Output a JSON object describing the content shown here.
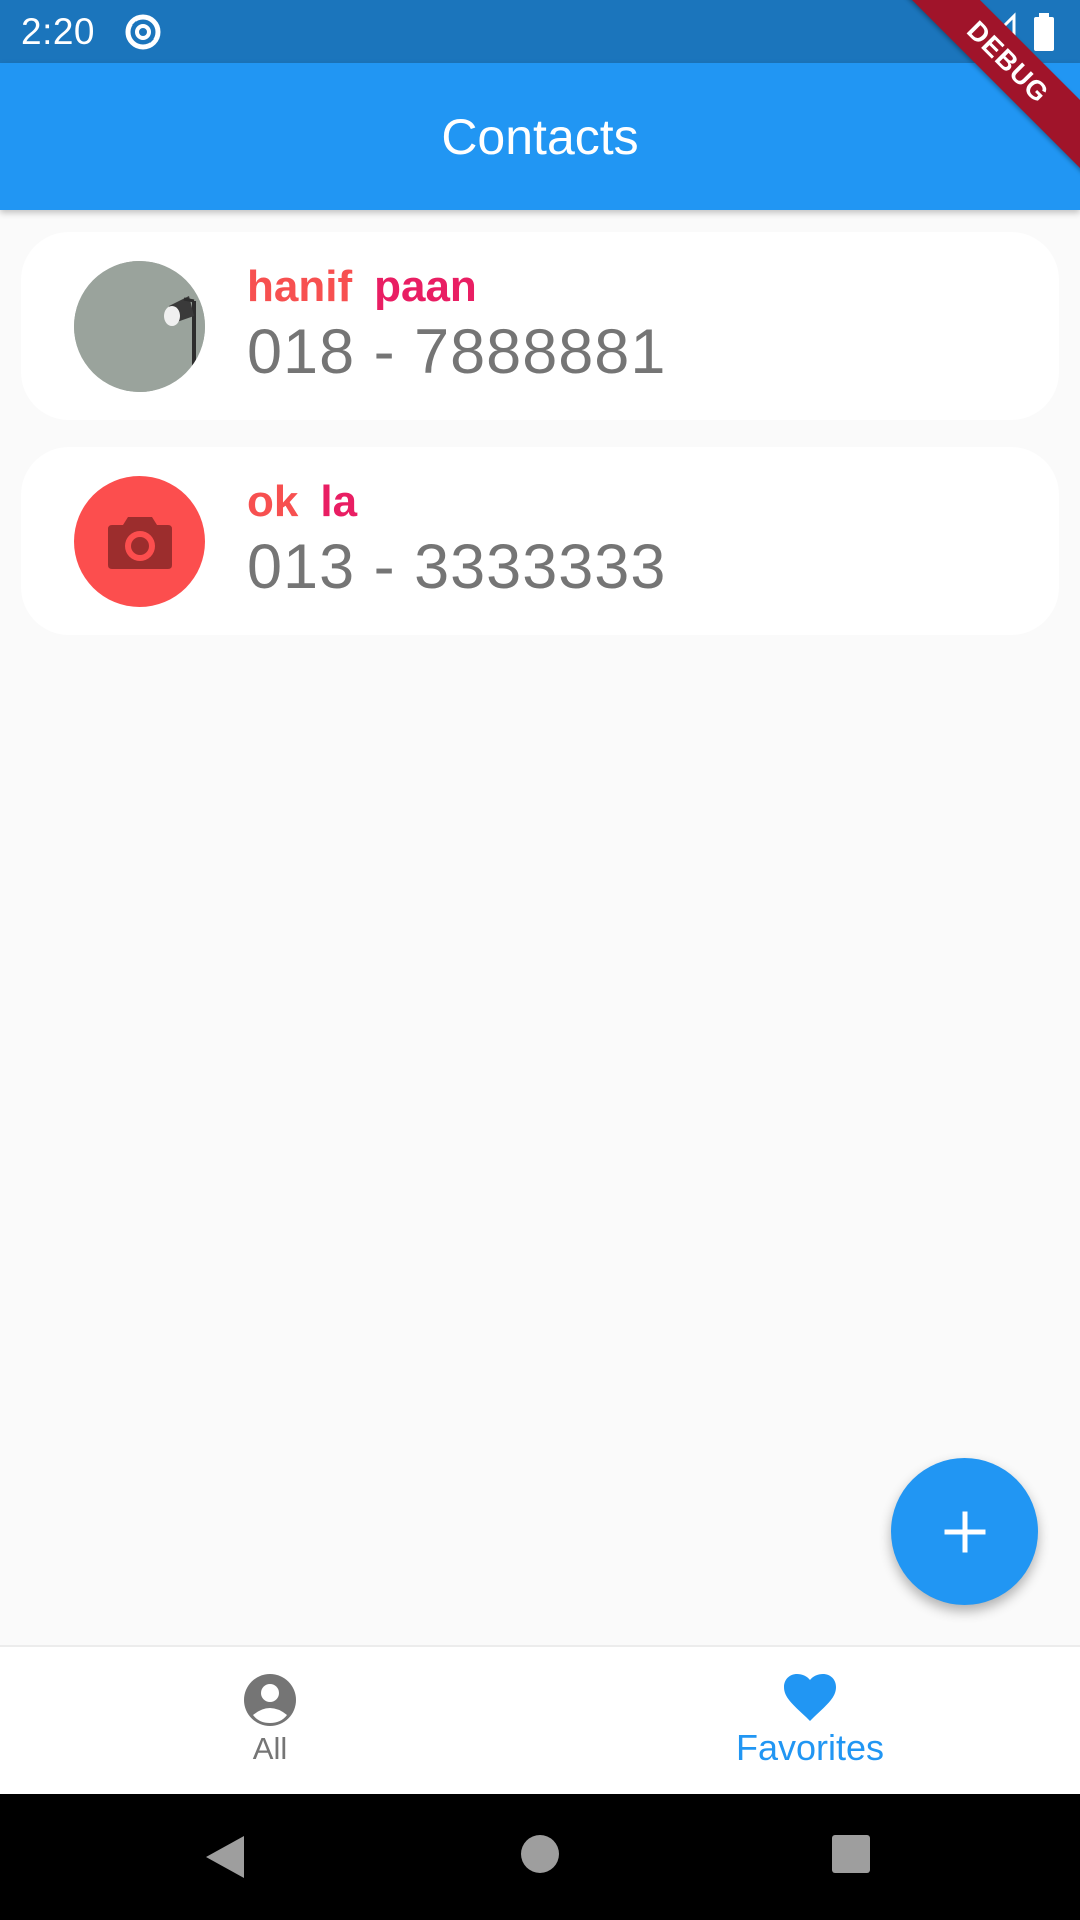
{
  "status_bar": {
    "time": "2:20",
    "app_icon": "sync-icon",
    "signal_icon": "signal-icon",
    "battery_icon": "battery-icon",
    "background": "#1b75bc"
  },
  "app_bar": {
    "title": "Contacts",
    "color": "#2196f3"
  },
  "debug_banner": {
    "label": "DEBUG"
  },
  "contacts": [
    {
      "first_name": "hanif",
      "last_name": "paan",
      "phone": "018 - 7888881",
      "avatar": "photo-avatar"
    },
    {
      "first_name": "ok",
      "last_name": "la",
      "phone": "013 - 3333333",
      "avatar": "camera-icon"
    }
  ],
  "fab": {
    "icon": "plus-icon"
  },
  "bottom_nav": {
    "items": [
      {
        "label": "All",
        "icon": "account-circle-icon",
        "selected": false
      },
      {
        "label": "Favorites",
        "icon": "heart-icon",
        "selected": true
      }
    ]
  },
  "system_nav": {
    "back": "back-icon",
    "home": "home-icon",
    "recents": "recents-icon"
  }
}
